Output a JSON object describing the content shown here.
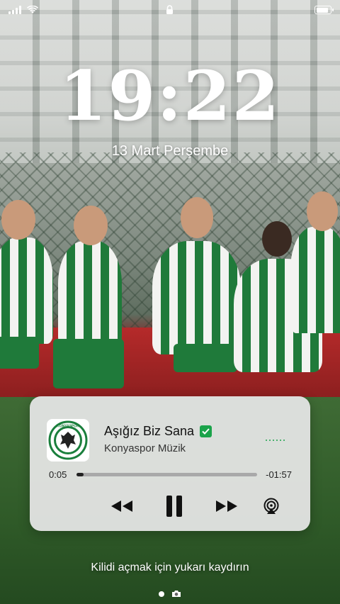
{
  "status_bar": {
    "signal_icon": "cellular-signal-icon",
    "wifi_icon": "wifi-icon",
    "lock_icon": "lock-icon",
    "battery_icon": "battery-icon",
    "battery_level": 0.85
  },
  "lock_screen": {
    "time": "19:22",
    "date": "13 Mart Perşembe",
    "unlock_hint": "Kilidi açmak için yukarı kaydırın"
  },
  "now_playing": {
    "title": "Aşığız Biz Sana",
    "artist": "Konyaspor Müzik",
    "artwork_text": "KONYASPOR",
    "elapsed": "0:05",
    "remaining": "-01:57",
    "progress": 0.04,
    "accent_color": "#1aa34a"
  },
  "pager": {
    "camera_icon": "camera-icon"
  }
}
